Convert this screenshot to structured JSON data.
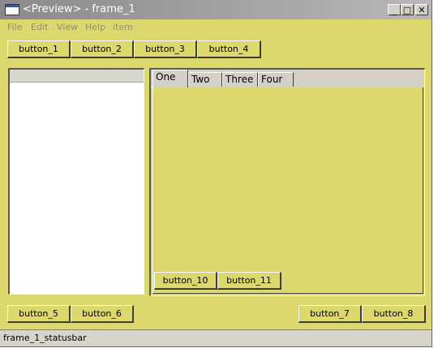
{
  "window": {
    "title": "<Preview> - frame_1",
    "controls": {
      "minimize": "_",
      "maximize": "□",
      "close": "✕"
    }
  },
  "menubar": {
    "items": [
      "File",
      "Edit",
      "View",
      "Help",
      "item"
    ]
  },
  "top_toolbar": {
    "buttons": [
      "button_1",
      "button_2",
      "button_3",
      "button_4"
    ]
  },
  "tabs": {
    "labels": [
      "One",
      "Two",
      "Three",
      "Four"
    ],
    "active": "One",
    "content_buttons": [
      "button_10",
      "button_11"
    ]
  },
  "bottom_toolbar": {
    "left_buttons": [
      "button_5",
      "button_6"
    ],
    "right_buttons": [
      "button_7",
      "button_8"
    ]
  },
  "statusbar": {
    "text": "frame_1_statusbar"
  },
  "colors": {
    "background": "#dcd86e",
    "titlebar": "#8a8a8a",
    "tabstrip": "#d4d0c8"
  }
}
